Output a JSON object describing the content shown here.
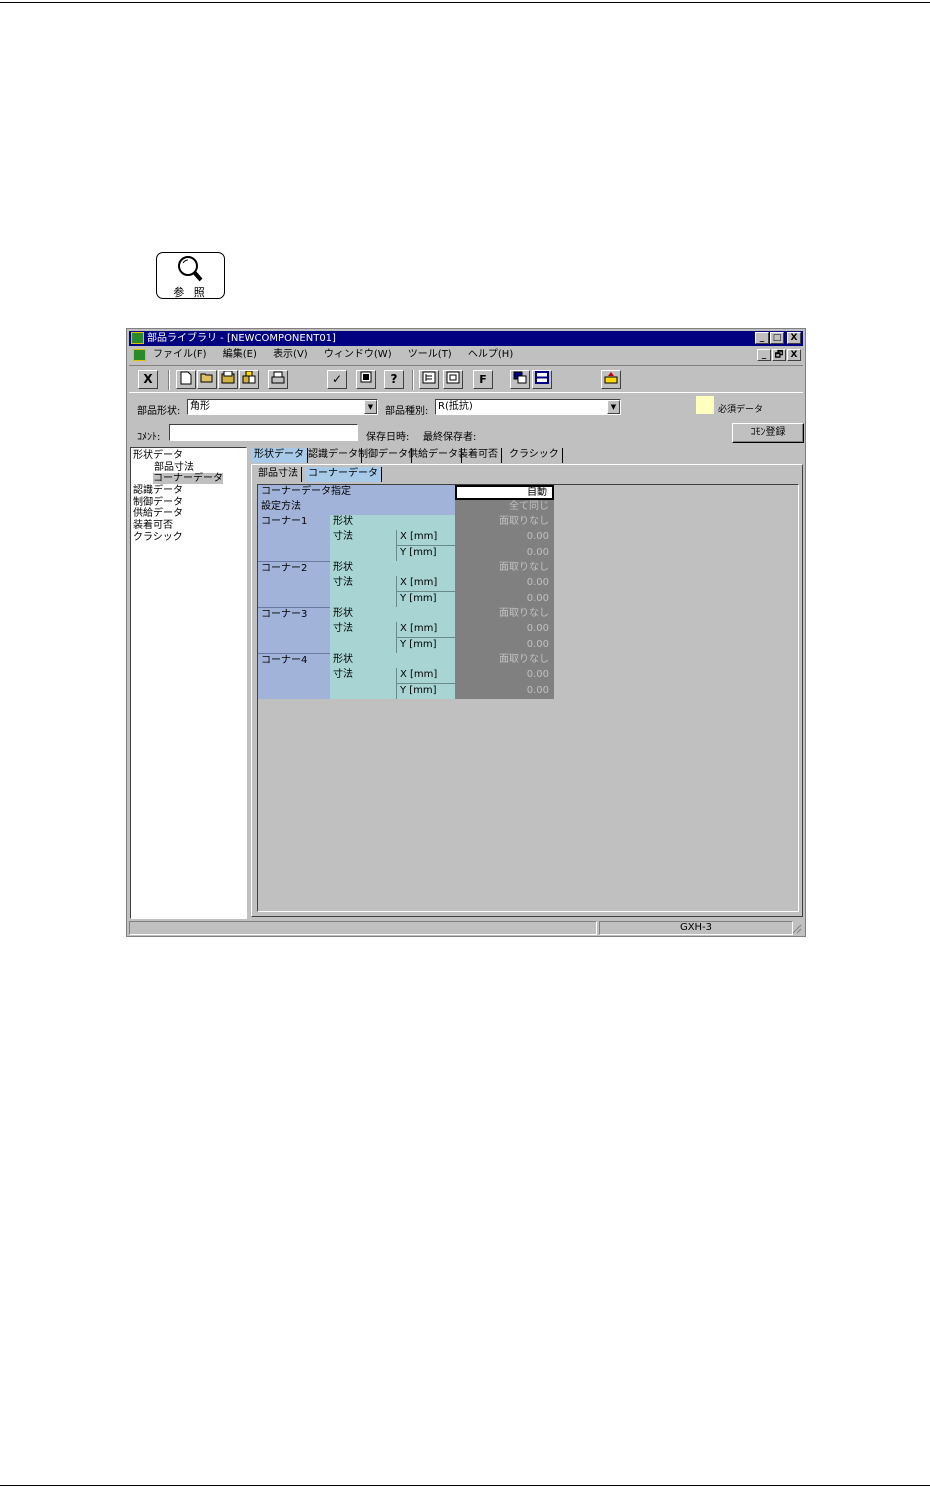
{
  "reference": {
    "label": "参 照",
    "icon": "magnifier-icon"
  },
  "window": {
    "title": "部品ライブラリ - [NEWCOMPONENT01]",
    "buttons": {
      "minimize": "_",
      "maximize": "□",
      "close": "X",
      "restore": "🗗"
    }
  },
  "menu": [
    "ファイル(F)",
    "編集(E)",
    "表示(V)",
    "ウィンドウ(W)",
    "ツール(T)",
    "ヘルプ(H)"
  ],
  "toolbar": {
    "icons": [
      "close-icon",
      "new-icon",
      "open-icon",
      "save-icon",
      "save-all-icon",
      "print-icon",
      "check-icon",
      "register-icon",
      "help-icon",
      "tree-icon",
      "image-icon",
      "font-icon",
      "window-icon",
      "split-icon",
      "export-icon"
    ],
    "glyphs": {
      "close": "X",
      "new": "🗋",
      "check": "✓",
      "help": "?",
      "font": "F"
    }
  },
  "properties": {
    "shape_label": "部品形状:",
    "shape_value": "角形",
    "type_label": "部品種別:",
    "type_value": "R(抵抗)",
    "required_label": "必須データ",
    "required_color": "#ffffc0",
    "comment_label": "ｺﾒﾝﾄ:",
    "comment_value": "",
    "saved_label": "保存日時:",
    "saver_label": "最終保存者:",
    "common_button": "ｺﾓﾝ登録"
  },
  "tree": {
    "items": [
      {
        "label": "形状データ"
      },
      {
        "label": "部品寸法"
      },
      {
        "label": "コーナーデータ"
      },
      {
        "label": "認識データ"
      },
      {
        "label": "制御データ"
      },
      {
        "label": "供給データ"
      },
      {
        "label": "装着可否"
      },
      {
        "label": "クラシック"
      }
    ]
  },
  "tabs": [
    "形状データ",
    "認識データ",
    "制御データ",
    "供給データ",
    "装着可否",
    "クラシック"
  ],
  "subtabs": [
    "部品寸法",
    "コーナーデータ"
  ],
  "grid": {
    "corner_spec_label": "コーナーデータ指定",
    "corner_spec_value": "自動",
    "method_label": "設定方法",
    "method_value": "全て同じ",
    "shape_label": "形状",
    "size_label": "寸法",
    "x_label": "X [mm]",
    "y_label": "Y [mm]",
    "corners": [
      {
        "name": "コーナー1",
        "shape": "面取りなし",
        "x": "0.00",
        "y": "0.00"
      },
      {
        "name": "コーナー2",
        "shape": "面取りなし",
        "x": "0.00",
        "y": "0.00"
      },
      {
        "name": "コーナー3",
        "shape": "面取りなし",
        "x": "0.00",
        "y": "0.00"
      },
      {
        "name": "コーナー4",
        "shape": "面取りなし",
        "x": "0.00",
        "y": "0.00"
      }
    ]
  },
  "status": {
    "machine": "GXH-3"
  }
}
